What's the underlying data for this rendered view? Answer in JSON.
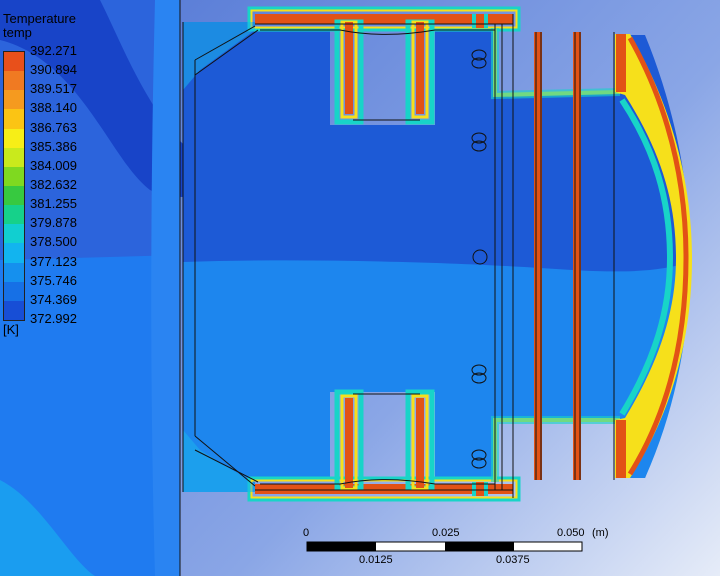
{
  "legend": {
    "title": "Temperature",
    "subtitle": "temp",
    "unit": "[K]",
    "values": [
      "392.271",
      "390.894",
      "389.517",
      "388.140",
      "386.763",
      "385.386",
      "384.009",
      "382.632",
      "381.255",
      "379.878",
      "378.500",
      "377.123",
      "375.746",
      "374.369",
      "372.992"
    ],
    "colors": [
      "#e8501b",
      "#f07a22",
      "#f59a1f",
      "#fbc414",
      "#f7ee17",
      "#c9ea1c",
      "#7fd920",
      "#37c940",
      "#16d18a",
      "#11cfd0",
      "#12b4ef",
      "#1590ee",
      "#1670e6",
      "#174ed6",
      "#1c2fc8"
    ]
  },
  "scale": {
    "top_labels": [
      "0",
      "0.025",
      "0.050"
    ],
    "bottom_labels": [
      "0.0125",
      "0.0375"
    ],
    "unit": "(m)"
  },
  "colors": {
    "bg_light": "#5b8cec",
    "bg_dark": "#2a5cd8",
    "hot": "#e25216",
    "mid": "#f6e01b",
    "cyan": "#18d4c8"
  }
}
